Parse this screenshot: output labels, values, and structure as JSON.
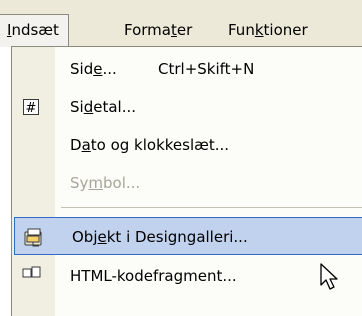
{
  "menubar": {
    "items": [
      {
        "pre": "",
        "key": "I",
        "post": "ndsæt"
      },
      {
        "pre": "Forma",
        "key": "t",
        "post": "er"
      },
      {
        "pre": "Fun",
        "key": "k",
        "post": "tioner"
      }
    ]
  },
  "dropdown": {
    "items": [
      {
        "pre": "Sid",
        "key": "e",
        "post": "...",
        "shortcut": "Ctrl+Skift+N",
        "icon": "none",
        "disabled": false
      },
      {
        "pre": "Si",
        "key": "d",
        "post": "etal...",
        "shortcut": "",
        "icon": "page-number-icon",
        "disabled": false
      },
      {
        "pre": "D",
        "key": "a",
        "post": "to og klokkeslæt...",
        "shortcut": "",
        "icon": "none",
        "disabled": false
      },
      {
        "pre": "Sy",
        "key": "m",
        "post": "bol...",
        "shortcut": "",
        "icon": "none",
        "disabled": true
      },
      {
        "pre": "Obj",
        "key": "e",
        "post": "kt i Designgalleri...",
        "shortcut": "",
        "icon": "design-gallery-icon",
        "disabled": false,
        "highlighted": true
      },
      {
        "pre": "",
        "key": "",
        "post": "HTML-kodefragment...",
        "shortcut": "",
        "icon": "html-fragment-icon",
        "disabled": false
      }
    ]
  },
  "cursor": {
    "icon": "mouse-pointer-icon"
  },
  "colors": {
    "menubar_bg": "#ece9d8",
    "menu_bg": "#fcfcf9",
    "gutter_bg": "#f1efe2",
    "highlight_bg": "#c1d2ee",
    "highlight_border": "#316ac5",
    "disabled_text": "#a7a697"
  }
}
